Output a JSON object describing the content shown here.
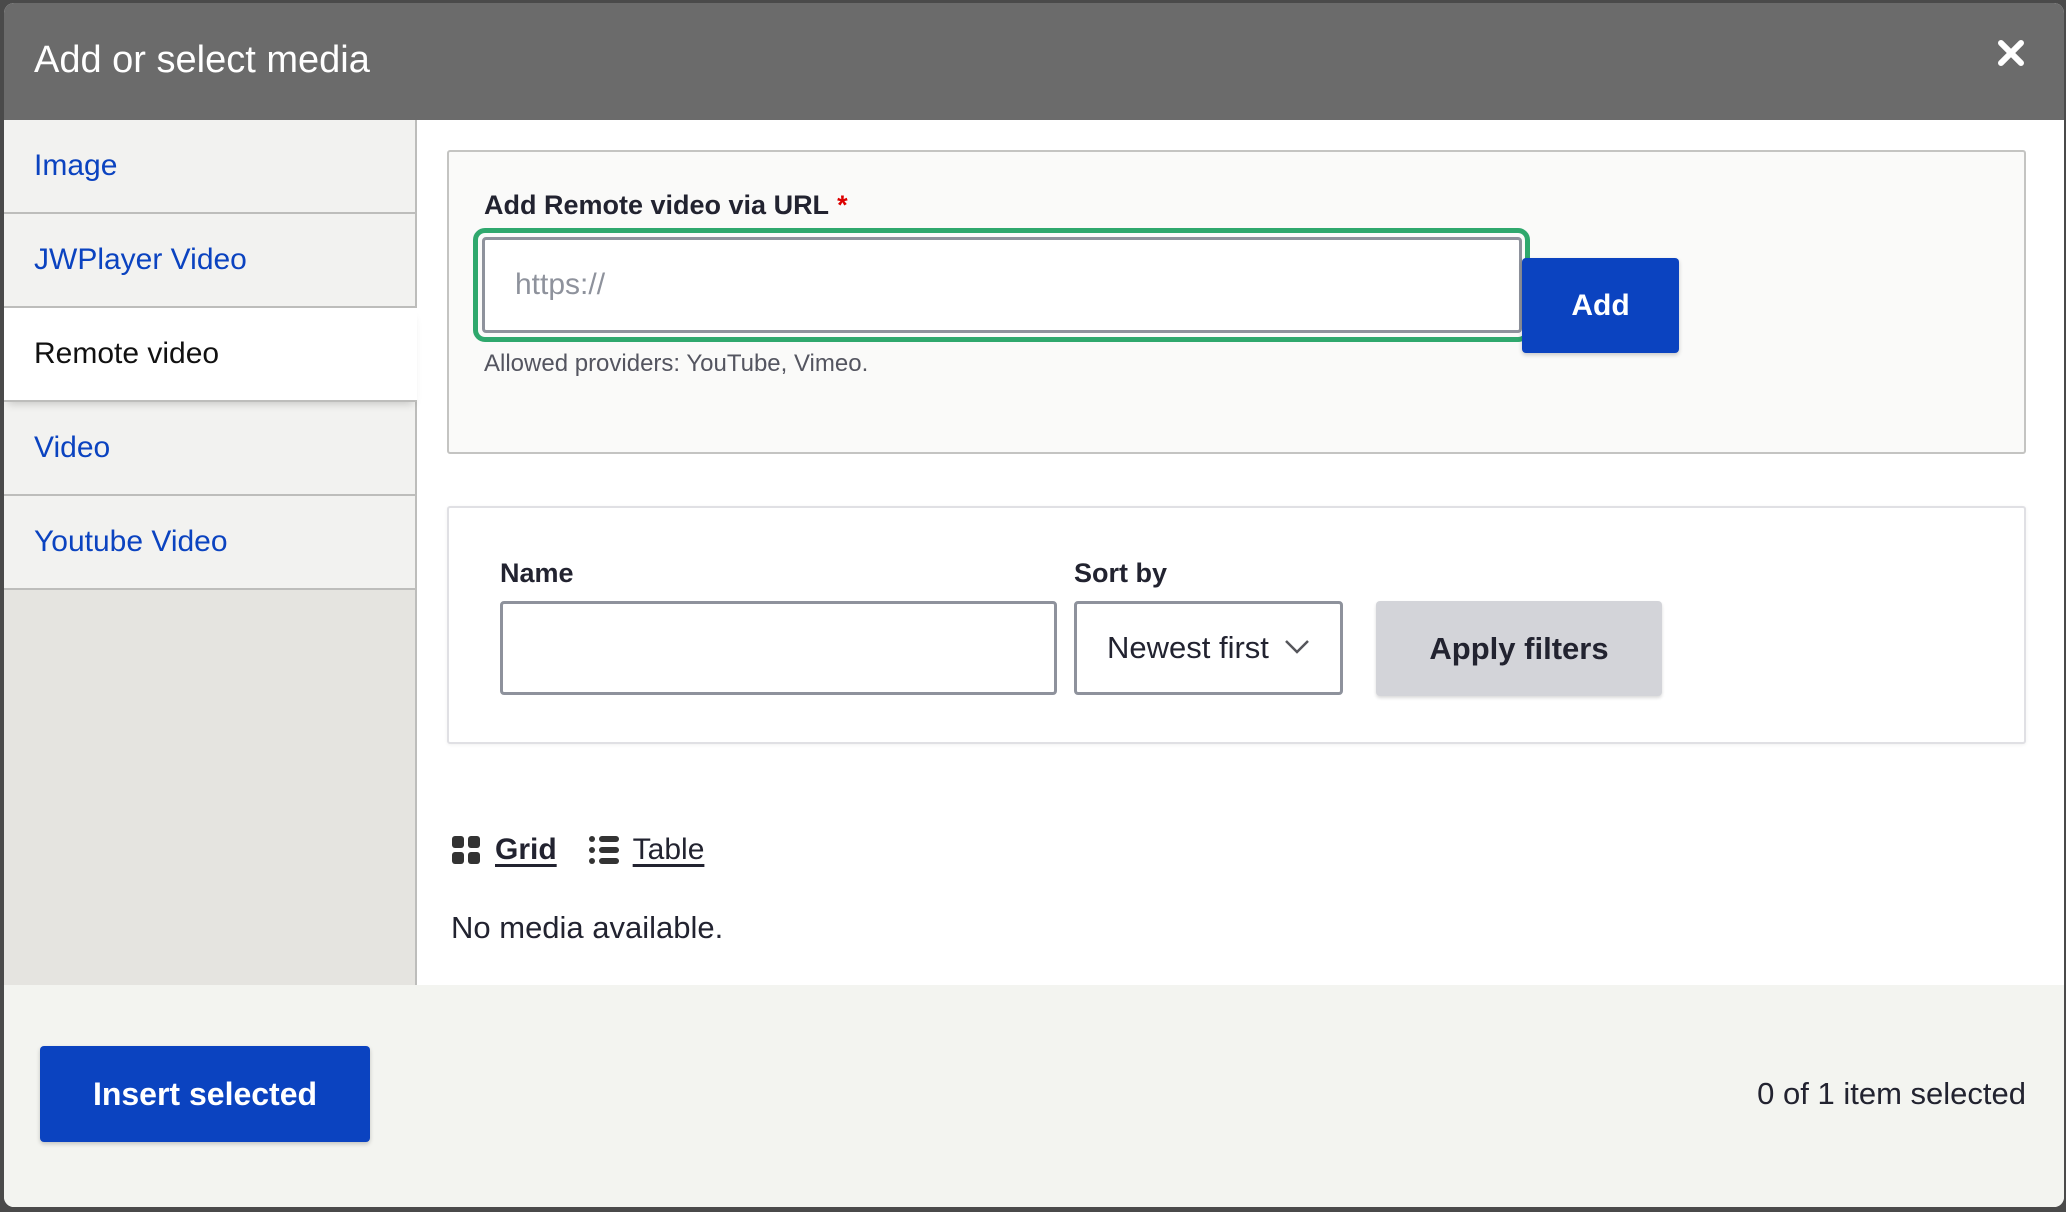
{
  "dialog": {
    "title": "Add or select media",
    "close_icon": "close-icon"
  },
  "sidebar": {
    "items": [
      {
        "label": "Image",
        "active": false
      },
      {
        "label": "JWPlayer Video",
        "active": false
      },
      {
        "label": "Remote video",
        "active": true
      },
      {
        "label": "Video",
        "active": false
      },
      {
        "label": "Youtube Video",
        "active": false
      }
    ]
  },
  "url_form": {
    "label": "Add Remote video via URL",
    "required_marker": "*",
    "placeholder": "https://",
    "value": "",
    "add_label": "Add",
    "hint": "Allowed providers: YouTube, Vimeo."
  },
  "filters": {
    "name_label": "Name",
    "name_value": "",
    "sort_label": "Sort by",
    "sort_value": "Newest first",
    "apply_label": "Apply filters"
  },
  "views": {
    "grid_label": "Grid",
    "table_label": "Table",
    "grid_icon": "grid-icon",
    "table_icon": "list-icon"
  },
  "results": {
    "empty_message": "No media available."
  },
  "footer": {
    "insert_label": "Insert selected",
    "selection_count": "0 of 1 item selected"
  },
  "colors": {
    "primary": "#0b43c0",
    "focus": "#2fa86d",
    "required": "#dc0000",
    "header_bg": "#6b6b6b"
  }
}
